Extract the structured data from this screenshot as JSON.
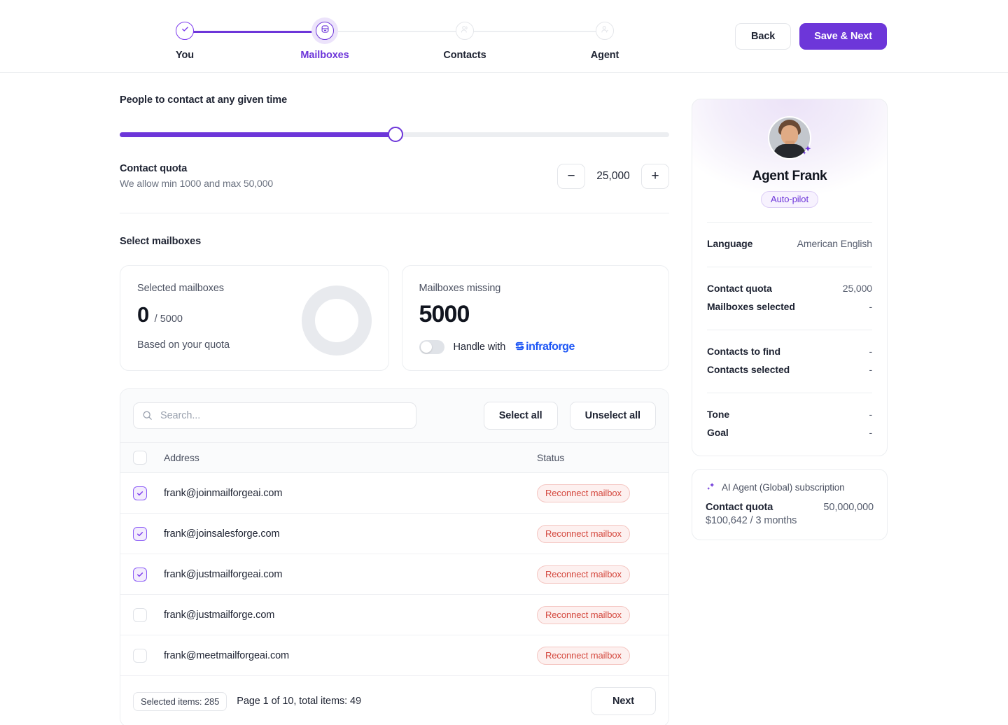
{
  "stepper": {
    "steps": [
      {
        "label": "You",
        "state": "done",
        "icon": "check-icon"
      },
      {
        "label": "Mailboxes",
        "state": "current",
        "icon": "mailbox-icon"
      },
      {
        "label": "Contacts",
        "state": "upcoming",
        "icon": "contacts-icon"
      },
      {
        "label": "Agent",
        "state": "upcoming",
        "icon": "agent-icon"
      }
    ]
  },
  "header": {
    "back_label": "Back",
    "save_next_label": "Save & Next"
  },
  "main": {
    "slider_title": "People to contact at any given time",
    "slider_percent": 50,
    "quota": {
      "label": "Contact quota",
      "sub": "We allow min 1000 and max 50,000",
      "value": "25,000",
      "minus": "−",
      "plus": "+"
    },
    "select_mailboxes_title": "Select mailboxes",
    "selected_card": {
      "title": "Selected mailboxes",
      "value": "0",
      "denominator": "/ 5000",
      "footer": "Based on your quota"
    },
    "missing_card": {
      "title": "Mailboxes missing",
      "value": "5000",
      "toggle_on": false,
      "handle_text": "Handle with",
      "brand": "infraforge"
    },
    "table": {
      "search_placeholder": "Search...",
      "search_value": "",
      "select_all_label": "Select all",
      "unselect_all_label": "Unselect all",
      "columns": {
        "address": "Address",
        "status": "Status"
      },
      "rows": [
        {
          "address": "frank@joinmailforgeai.com",
          "status": "Reconnect mailbox",
          "checked": true
        },
        {
          "address": "frank@joinsalesforge.com",
          "status": "Reconnect mailbox",
          "checked": true
        },
        {
          "address": "frank@justmailforgeai.com",
          "status": "Reconnect mailbox",
          "checked": true
        },
        {
          "address": "frank@justmailforge.com",
          "status": "Reconnect mailbox",
          "checked": false
        },
        {
          "address": "frank@meetmailforgeai.com",
          "status": "Reconnect mailbox",
          "checked": false
        }
      ],
      "footer": {
        "selected_chip": "Selected items: 285",
        "page_text": "Page 1 of 10, total items: 49",
        "next_label": "Next"
      }
    }
  },
  "sidebar": {
    "agent": {
      "name": "Agent Frank",
      "mode_pill": "Auto-pilot",
      "groups": [
        {
          "rows": [
            {
              "k": "Language",
              "v": "American English"
            }
          ]
        },
        {
          "rows": [
            {
              "k": "Contact quota",
              "v": "25,000"
            },
            {
              "k": "Mailboxes selected",
              "v": "-"
            }
          ]
        },
        {
          "rows": [
            {
              "k": "Contacts to find",
              "v": "-"
            },
            {
              "k": "Contacts selected",
              "v": "-"
            }
          ]
        },
        {
          "rows": [
            {
              "k": "Tone",
              "v": "-"
            },
            {
              "k": "Goal",
              "v": "-"
            }
          ]
        }
      ]
    },
    "subscription": {
      "title": "AI Agent (Global) subscription",
      "quota_label": "Contact quota",
      "quota_value": "50,000,000",
      "price": "$100,642 / 3 months"
    }
  },
  "colors": {
    "accent": "#6d36d9",
    "accent_light": "#8b5cf6",
    "danger": "#d4483e",
    "brand_blue": "#1c55f5",
    "border": "#eceef1",
    "text": "#1f2433"
  }
}
